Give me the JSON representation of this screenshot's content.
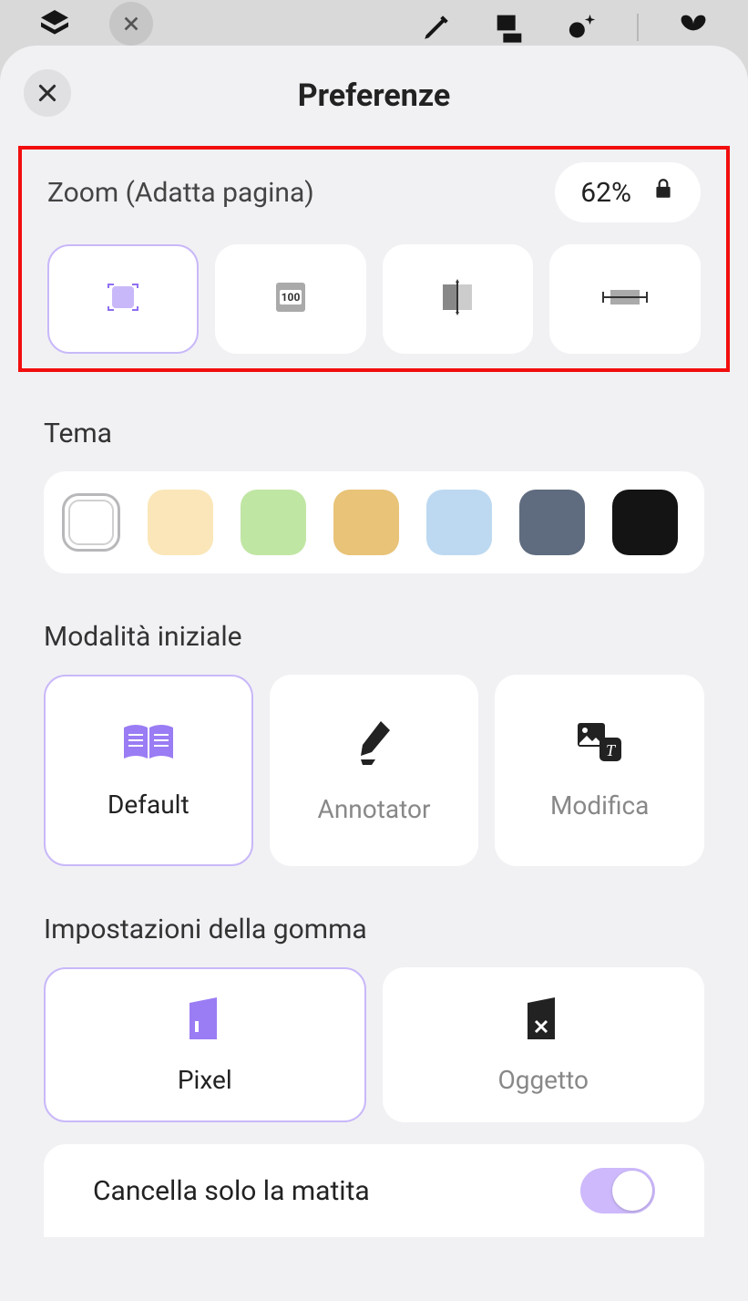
{
  "header": {
    "title": "Preferenze"
  },
  "zoom": {
    "label": "Zoom (Adatta pagina)",
    "value": "62%",
    "options": [
      {
        "name": "fit-page",
        "selected": true
      },
      {
        "name": "zoom-100",
        "selected": false
      },
      {
        "name": "fit-width",
        "selected": false
      },
      {
        "name": "fit-height",
        "selected": false
      }
    ]
  },
  "theme": {
    "label": "Tema",
    "colors": [
      "#ffffff",
      "#fae6b8",
      "#c0e6a4",
      "#e8c378",
      "#bdd9f1",
      "#5f6b7e",
      "#141414"
    ],
    "selected_index": 0
  },
  "initial_mode": {
    "label": "Modalità iniziale",
    "options": [
      {
        "label": "Default",
        "selected": true
      },
      {
        "label": "Annotator",
        "selected": false
      },
      {
        "label": "Modifica",
        "selected": false
      }
    ]
  },
  "eraser": {
    "label": "Impostazioni della gomma",
    "options": [
      {
        "label": "Pixel",
        "selected": true
      },
      {
        "label": "Oggetto",
        "selected": false
      }
    ],
    "pencil_only_label": "Cancella solo la matita",
    "pencil_only_value": true
  }
}
